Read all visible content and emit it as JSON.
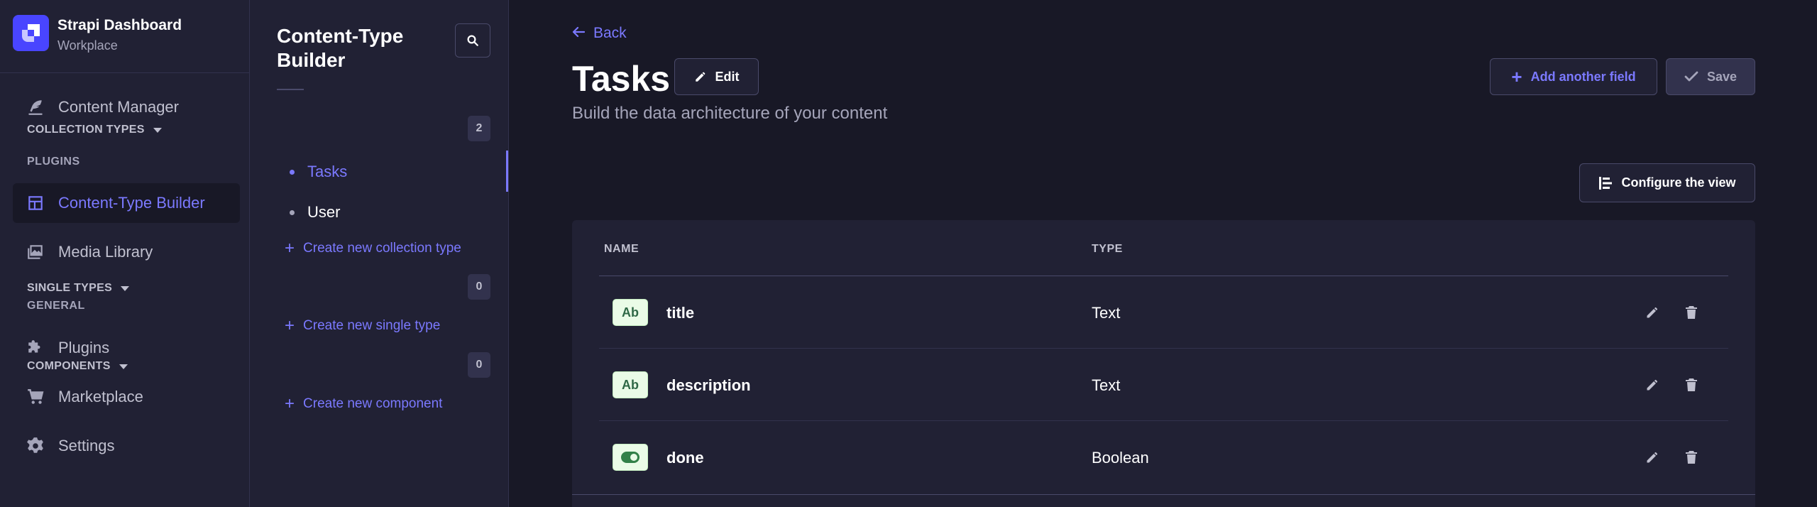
{
  "brand": {
    "title": "Strapi Dashboard",
    "subtitle": "Workplace"
  },
  "mainnav": {
    "content_manager": "Content Manager",
    "plugins_section": "PLUGINS",
    "content_type_builder": "Content-Type Builder",
    "media_library": "Media Library",
    "general_section": "GENERAL",
    "plugins": "Plugins",
    "marketplace": "Marketplace",
    "settings": "Settings"
  },
  "subnav": {
    "title": "Content-Type Builder",
    "collection_types": {
      "label": "COLLECTION TYPES",
      "count": "2",
      "items": [
        "Tasks",
        "User"
      ],
      "create": "Create new collection type"
    },
    "single_types": {
      "label": "SINGLE TYPES",
      "count": "0",
      "create": "Create new single type"
    },
    "components": {
      "label": "COMPONENTS",
      "count": "0",
      "create": "Create new component"
    }
  },
  "header": {
    "back": "Back",
    "title": "Tasks",
    "edit": "Edit",
    "subtitle": "Build the data architecture of your content",
    "add_field": "Add another field",
    "save": "Save",
    "configure_view": "Configure the view"
  },
  "table": {
    "columns": {
      "name": "NAME",
      "type": "TYPE"
    },
    "rows": [
      {
        "icon": "Ab",
        "icon_name": "text-icon",
        "name": "title",
        "type": "Text"
      },
      {
        "icon": "Ab",
        "icon_name": "text-icon",
        "name": "description",
        "type": "Text"
      },
      {
        "icon": "",
        "icon_name": "boolean-toggle-icon",
        "name": "done",
        "type": "Boolean"
      }
    ]
  },
  "colors": {
    "accent": "#7b79ff",
    "primary": "#4945ff",
    "background": "#181826",
    "surface": "#212134"
  }
}
